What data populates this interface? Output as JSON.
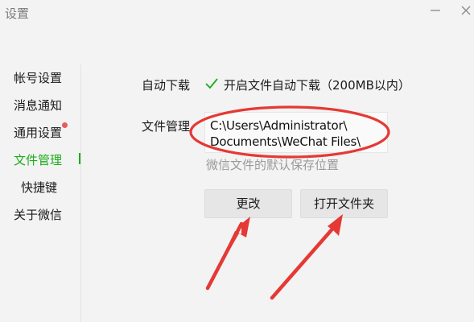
{
  "window": {
    "title": "设置"
  },
  "sidebar": {
    "items": [
      {
        "label": "帐号设置"
      },
      {
        "label": "消息通知"
      },
      {
        "label": "通用设置"
      },
      {
        "label": "文件管理"
      },
      {
        "label": "快捷键"
      },
      {
        "label": "关于微信"
      }
    ],
    "active": "文件管理"
  },
  "main": {
    "auto_download": {
      "label": "自动下载",
      "checkbox_text": "开启文件自动下载（200MB以内）",
      "checked": true
    },
    "file_manage": {
      "label": "文件管理",
      "path_line1": "C:\\Users\\Administrator\\",
      "path_line2": "Documents\\WeChat Files\\",
      "hint": "微信文件的默认保存位置"
    },
    "buttons": {
      "change": "更改",
      "open_folder": "打开文件夹"
    }
  },
  "colors": {
    "accent": "#1aad19",
    "annotation_red": "#e53935",
    "notification_dot": "#e85c5c"
  }
}
